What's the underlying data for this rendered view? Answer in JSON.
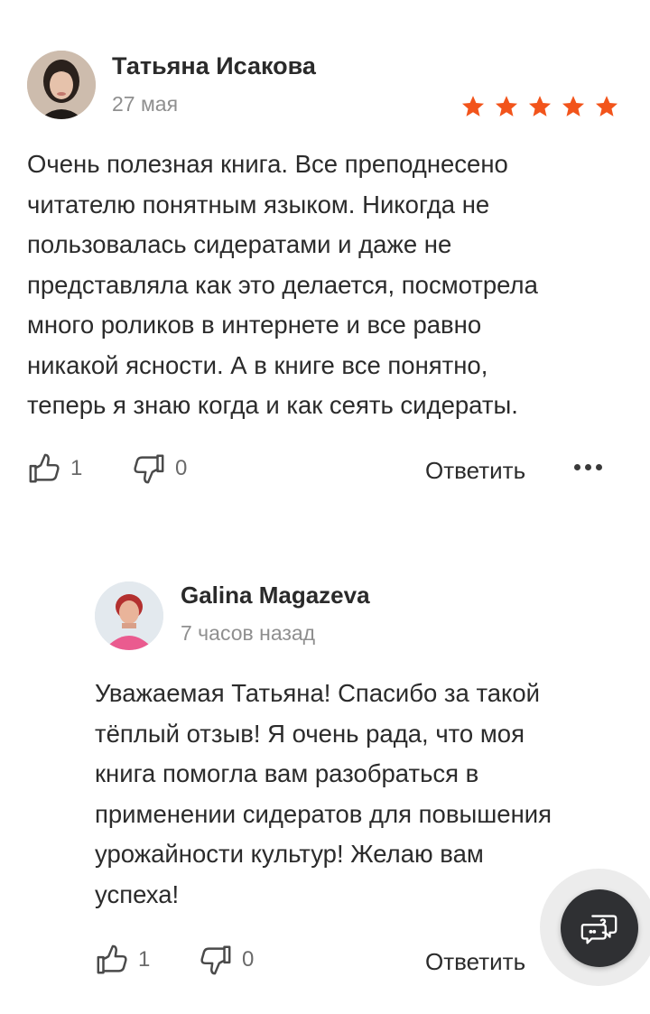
{
  "colors": {
    "star": "#f2541b",
    "text": "#2b2b2b",
    "muted": "#8f8f8f",
    "fab": "#2f3033"
  },
  "review": {
    "author": "Татьяна Исакова",
    "date": "27 мая",
    "rating": 5,
    "rating_max": 5,
    "text": "Очень полезная книга. Все преподнесено\nчитателю понятным языком. Никогда не\nпользовалась сидератами и даже не\nпредставляла как это делается, посмотрела\nмного роликов в интернете и все равно\nникакой ясности. А в книге все понятно,\nтеперь я знаю когда и как сеять сидераты.",
    "likes": "1",
    "dislikes": "0",
    "reply_label": "Ответить",
    "icons": {
      "like": "thumbs-up-icon",
      "dislike": "thumbs-down-icon",
      "more": "more-dots-icon"
    }
  },
  "reply": {
    "author": "Galina Magazeva",
    "date": "7 часов назад",
    "text": "Уважаемая Татьяна! Спасибо за такой\nтёплый отзыв! Я очень рада, что моя\nкнига помогла вам разобраться в\nприменении сидератов для повышения\nурожайности культур! Желаю вам\nуспеха!",
    "likes": "1",
    "dislikes": "0",
    "reply_label": "Ответить"
  },
  "help_fab": {
    "icon": "help-chat-icon"
  }
}
